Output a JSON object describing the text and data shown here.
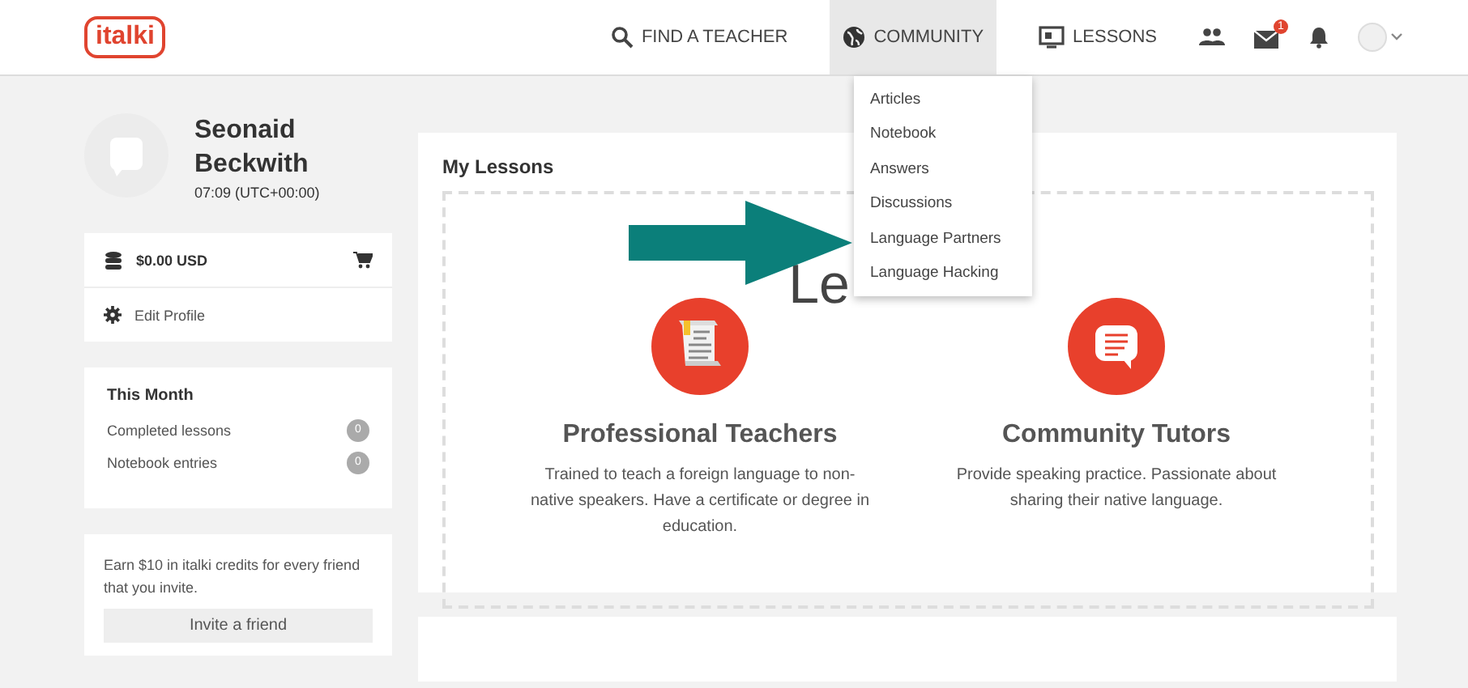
{
  "nav": {
    "logo": "italki",
    "items": [
      {
        "label": "FIND A TEACHER",
        "kind": "search",
        "selected": false
      },
      {
        "label": "COMMUNITY",
        "kind": "globe",
        "selected": true
      },
      {
        "label": "LESSONS",
        "kind": "screen",
        "selected": false
      }
    ],
    "mail_badge": "1"
  },
  "community_menu": [
    "Articles",
    "Notebook",
    "Answers",
    "Discussions",
    "Language Partners",
    "Language Hacking"
  ],
  "profile": {
    "first_name": "Seonaid",
    "last_name": "Beckwith",
    "time": "07:09 (UTC+00:00)"
  },
  "account": {
    "balance": "$0.00 USD",
    "edit": "Edit Profile"
  },
  "this_month": {
    "title": "This Month",
    "rows": [
      {
        "label": "Completed lessons",
        "count": "0"
      },
      {
        "label": "Notebook entries",
        "count": "0"
      }
    ]
  },
  "invite": {
    "text": "Earn $10 in italki credits for every friend that you invite.",
    "button": "Invite a friend"
  },
  "lessons": {
    "title": "My Lessons",
    "heading": "Le",
    "columns": [
      {
        "kind": "scroll",
        "title": "Professional Teachers",
        "text": "Trained to teach a foreign language to non-native speakers. Have a certificate or degree in education."
      },
      {
        "kind": "chat",
        "title": "Community Tutors",
        "text": "Provide speaking practice. Passionate about sharing their native language."
      }
    ]
  }
}
